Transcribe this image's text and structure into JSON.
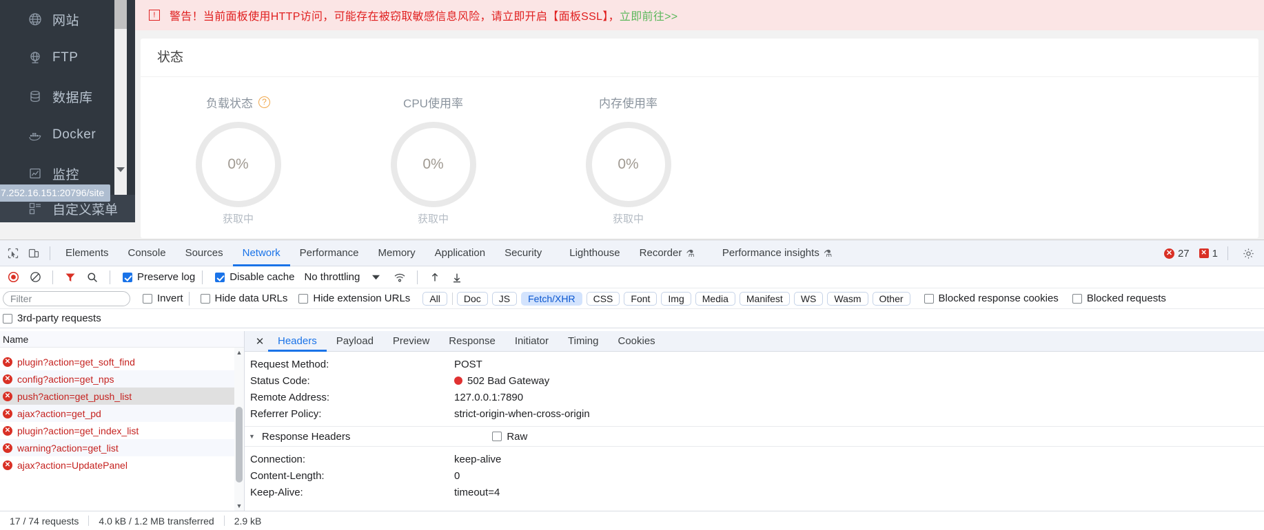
{
  "panel": {
    "sidebar": {
      "items": [
        {
          "label": "网站",
          "icon": "globe-icon"
        },
        {
          "label": "FTP",
          "icon": "ftp-globe-icon"
        },
        {
          "label": "数据库",
          "icon": "database-icon"
        },
        {
          "label": "Docker",
          "icon": "docker-icon"
        },
        {
          "label": "监控",
          "icon": "monitor-chart-icon"
        }
      ],
      "partial_item": {
        "label": "自定义菜单",
        "icon": "menu-grid-icon"
      }
    },
    "status_url_tooltip": "7.252.16.151:20796/site",
    "warning": {
      "icon": "warning-icon",
      "text": "警告！当前面板使用HTTP访问，可能存在被窃取敏感信息风险，请立即开启【面板SSL】，",
      "link": "立即前往>>"
    },
    "card_title": "状态",
    "gauges": [
      {
        "label": "负载状态",
        "help": "?",
        "value": "0%",
        "sub": "获取中"
      },
      {
        "label": "CPU使用率",
        "value": "0%",
        "sub": "获取中"
      },
      {
        "label": "内存使用率",
        "value": "0%",
        "sub": "获取中"
      }
    ]
  },
  "devtools": {
    "tabs": [
      {
        "label": "Elements",
        "active": false
      },
      {
        "label": "Console",
        "active": false
      },
      {
        "label": "Sources",
        "active": false
      },
      {
        "label": "Network",
        "active": true
      },
      {
        "label": "Performance",
        "active": false
      },
      {
        "label": "Memory",
        "active": false
      },
      {
        "label": "Application",
        "active": false
      },
      {
        "label": "Security",
        "active": false
      },
      {
        "label": "Lighthouse",
        "active": false
      },
      {
        "label": "Recorder",
        "active": false,
        "flask": "⚗"
      },
      {
        "label": "Performance insights",
        "active": false,
        "flask": "⚗"
      }
    ],
    "error_count": "27",
    "warning_count": "1",
    "network_toolbar": {
      "preserve_log": {
        "label": "Preserve log",
        "checked": true
      },
      "disable_cache": {
        "label": "Disable cache",
        "checked": true
      },
      "throttling": "No throttling"
    },
    "filter_row": {
      "filter_placeholder": "Filter",
      "invert": {
        "label": "Invert",
        "checked": false
      },
      "hide_data_urls": {
        "label": "Hide data URLs",
        "checked": false
      },
      "hide_extension_urls": {
        "label": "Hide extension URLs",
        "checked": false
      },
      "types": [
        "All",
        "Doc",
        "JS",
        "Fetch/XHR",
        "CSS",
        "Font",
        "Img",
        "Media",
        "Manifest",
        "WS",
        "Wasm",
        "Other"
      ],
      "selected_type": "Fetch/XHR",
      "blocked_response_cookies": {
        "label": "Blocked response cookies",
        "checked": false
      },
      "blocked_requests": {
        "label": "Blocked requests",
        "checked": false
      },
      "third_party_requests": {
        "label": "3rd-party requests",
        "checked": false
      }
    },
    "request_list": {
      "column_header": "Name",
      "rows": [
        {
          "name": "plugin?action=get_soft_find",
          "selected": false
        },
        {
          "name": "config?action=get_nps",
          "selected": false
        },
        {
          "name": "push?action=get_push_list",
          "selected": true
        },
        {
          "name": "ajax?action=get_pd",
          "selected": false
        },
        {
          "name": "plugin?action=get_index_list",
          "selected": false
        },
        {
          "name": "warning?action=get_list",
          "selected": false
        },
        {
          "name": "ajax?action=UpdatePanel",
          "selected": false
        }
      ]
    },
    "details": {
      "tabs": [
        "Headers",
        "Payload",
        "Preview",
        "Response",
        "Initiator",
        "Timing",
        "Cookies"
      ],
      "active_tab": "Headers",
      "general": [
        {
          "key": "Request Method:",
          "value": "POST"
        },
        {
          "key": "Status Code:",
          "value": "502 Bad Gateway",
          "dot": true
        },
        {
          "key": "Remote Address:",
          "value": "127.0.0.1:7890"
        },
        {
          "key": "Referrer Policy:",
          "value": "strict-origin-when-cross-origin"
        }
      ],
      "response_headers_label": "Response Headers",
      "raw_label": "Raw",
      "response_headers": [
        {
          "key": "Connection:",
          "value": "keep-alive"
        },
        {
          "key": "Content-Length:",
          "value": "0"
        },
        {
          "key": "Keep-Alive:",
          "value": "timeout=4"
        }
      ]
    },
    "status_bar": {
      "requests": "17 / 74 requests",
      "transferred": "4.0 kB / 1.2 MB transferred",
      "resources": "2.9 kB"
    }
  },
  "colors": {
    "accent": "#1a73e8",
    "error": "#d93025",
    "sidebar_bg": "#30373f",
    "warning_bg": "#fbe5e5",
    "warning_text": "#e02020",
    "link_green": "#5cb85c"
  }
}
